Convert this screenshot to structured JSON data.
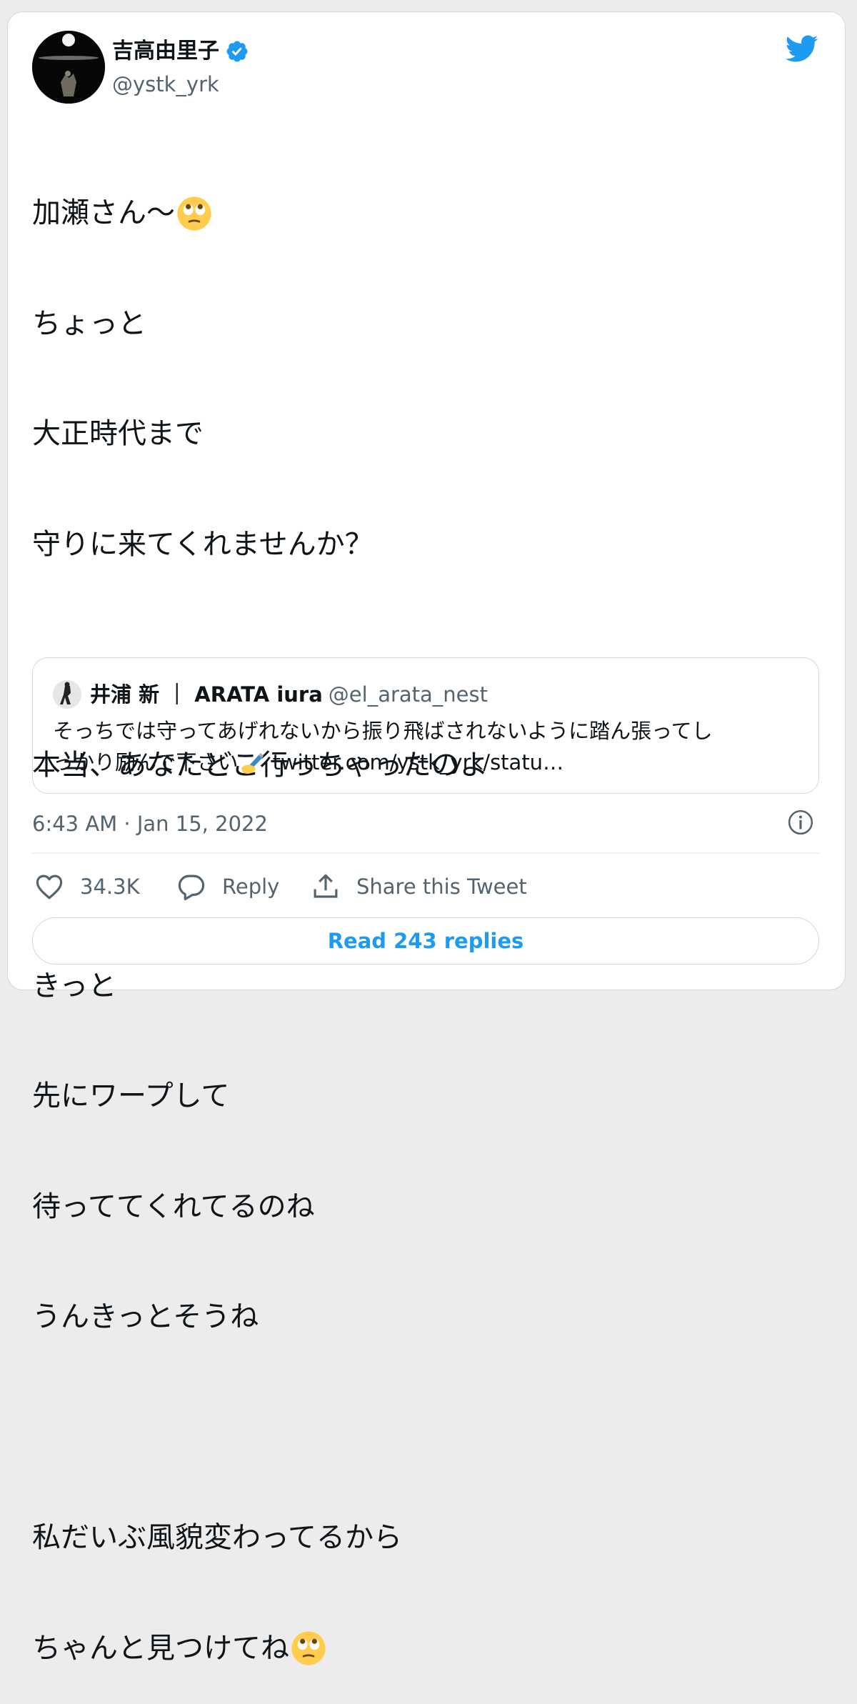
{
  "author": {
    "name": "吉高由里子",
    "handle": "@ystk_yrk"
  },
  "tweet": {
    "lines": [
      "加瀬さん〜",
      "ちょっと",
      "大正時代まで",
      "守りに来てくれませんか？",
      "",
      "本当、あなたどこ行っちゃったのよ",
      "",
      "きっと",
      "先にワープして",
      "待っててくれてるのね",
      "うんきっとそうね",
      "",
      "私だいぶ風貌変わってるから",
      "ちゃんと見つけてね"
    ],
    "emoji_icon": "face-with-rolling-eyes-emoji"
  },
  "quoted_tweet": {
    "name": "井浦 新 ｜ ARATA iura",
    "handle": "@el_arata_nest",
    "line1": "そっちでは守ってあげれないから振り飛ばされないように踏ん張ってし",
    "line2_text": "っかり励んで下さい",
    "line2_link": "twitter.com/ystk_yrk/statu…",
    "emoji_icon": "writing-hand-emoji"
  },
  "timestamp": "6:43 AM · Jan 15, 2022",
  "actions": {
    "likes": "34.3K",
    "reply": "Reply",
    "share": "Share this Tweet"
  },
  "read_replies": "Read 243 replies",
  "colors": {
    "accent": "#1d9bf0",
    "secondary_text": "#536471",
    "border": "#cfd9de",
    "emoji": "#ffcc4d"
  }
}
